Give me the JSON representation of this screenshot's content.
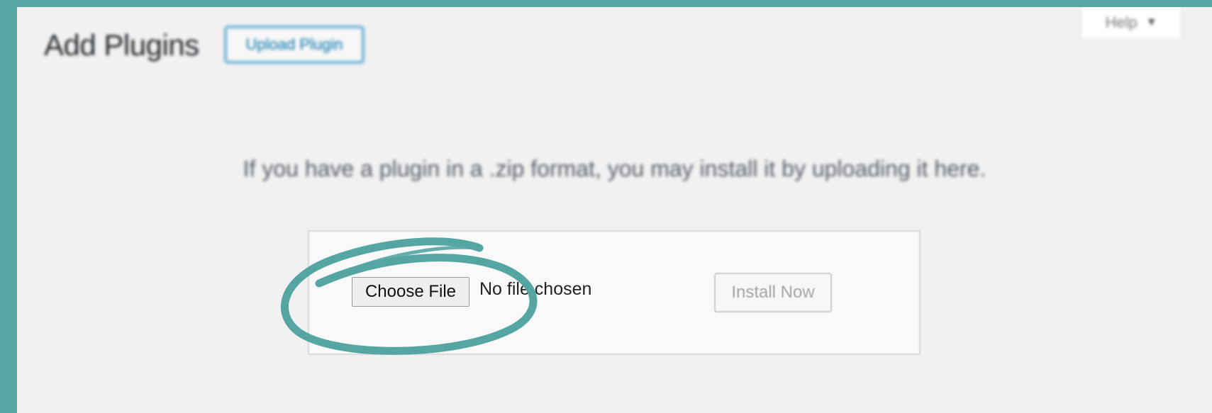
{
  "header": {
    "title": "Add Plugins",
    "upload_plugin_label": "Upload Plugin",
    "help_label": "Help",
    "help_arrow": "▼"
  },
  "main": {
    "instructions": "If you have a plugin in a .zip format, you may install it by uploading it here.",
    "file_input": {
      "button_label": "Choose File",
      "status": "No file chosen"
    },
    "install_label": "Install Now"
  },
  "annotation": {
    "color": "#55a5a3"
  }
}
